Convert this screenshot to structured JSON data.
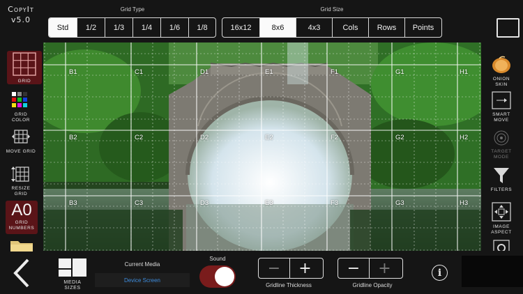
{
  "app": {
    "name": "CopyIt",
    "version": "v5.0"
  },
  "grid_type": {
    "title": "Grid Type",
    "options": [
      "Std",
      "1/2",
      "1/3",
      "1/4",
      "1/6",
      "1/8"
    ],
    "selected": "Std"
  },
  "grid_size": {
    "title": "Grid Size",
    "options": [
      "16x12",
      "8x6",
      "4x3",
      "Cols",
      "Rows",
      "Points"
    ],
    "selected": "8x6"
  },
  "left_tools": [
    {
      "label": "Grid",
      "icon": "grid-icon",
      "active": true
    },
    {
      "label": "Grid Color",
      "icon": "color-palette-icon"
    },
    {
      "label": "Move Grid",
      "icon": "move-grid-icon"
    },
    {
      "label": "Resize Grid",
      "icon": "resize-grid-icon"
    },
    {
      "label": "Grid Numbers",
      "icon": "grid-numbers-icon",
      "value": "A0",
      "active": true
    },
    {
      "label": "",
      "icon": "folder-icon"
    }
  ],
  "right_tools": [
    {
      "label": "Onion Skin",
      "icon": "onion-skin-icon"
    },
    {
      "label": "Smart Move",
      "icon": "smart-move-icon"
    },
    {
      "label": "Target Mode",
      "icon": "target-icon",
      "disabled": true
    },
    {
      "label": "Filters",
      "icon": "funnel-icon"
    },
    {
      "label": "Image Aspect",
      "icon": "image-aspect-icon"
    },
    {
      "label": "",
      "icon": "settings-icon"
    }
  ],
  "grid_labels": {
    "columns": [
      "B",
      "C",
      "D",
      "E",
      "F",
      "G",
      "H"
    ],
    "rows": [
      "1",
      "2",
      "3"
    ]
  },
  "bottom": {
    "media_sizes_label": "Media Sizes",
    "current_media_label": "Current Media",
    "current_media_value": "Device Screen",
    "sound_label": "Sound",
    "sound_on": true,
    "gridline_thickness_label": "Gridline Thickness",
    "gridline_opacity_label": "Gridline Opacity",
    "minus": "−",
    "plus": "+",
    "info": "i"
  },
  "colors": {
    "background": "#151515",
    "active_tool": "#5a1418",
    "toggle_on": "#7a1c1c",
    "media_value": "#3e8dde"
  }
}
